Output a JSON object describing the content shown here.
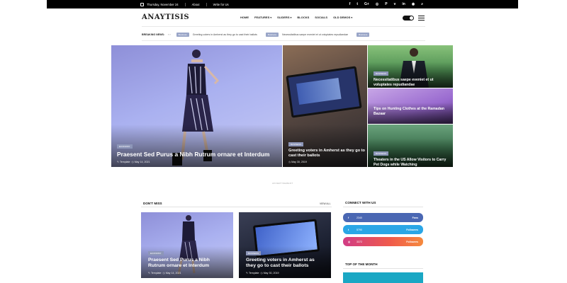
{
  "topbar": {
    "date": "Thursday, November 24",
    "links": [
      "About",
      "Write for Us"
    ],
    "social_icons": [
      "facebook-icon",
      "twitter-icon",
      "google-plus-icon",
      "instagram-icon",
      "pinterest-icon",
      "vimeo-icon",
      "linkedin-icon",
      "rss-icon",
      "search-icon"
    ],
    "social_glyphs": [
      "f",
      "t",
      "G+",
      "◎",
      "P",
      "v",
      "in",
      "◉",
      "⌕"
    ]
  },
  "header": {
    "logo": "ANAYTISIS",
    "nav": [
      "HOME",
      "FEATURES",
      "SLIDERS",
      "BLOCKS",
      "SOCIALS",
      "OLD DEMOS"
    ]
  },
  "breaking": {
    "label": "BREAKING NEWS:",
    "arrows": "‹ ›",
    "items": [
      {
        "tag": "Business",
        "text": "Greeting voters in Amherst as they go to cast their ballots"
      },
      {
        "tag": "Business",
        "text": "Necessitatibus saepe eveniet et ut voluptates repudiandae"
      },
      {
        "tag": "Business",
        "text": ""
      }
    ]
  },
  "hero": {
    "main": {
      "badge": "ECONOMY",
      "title": "Praesent Sed Purus a Nibh Rutrum ornare et Interdum",
      "author": "Template",
      "date": "May 14, 2021"
    },
    "second": {
      "badge": "BUSINESS",
      "title": "Greeting voters in Amherst as they go to cast their ballots",
      "date": "May 30, 2019"
    },
    "side": [
      {
        "badge": "BUSINESS",
        "title": "Necessitatibus saepe eveniet et ut voluptates repudiandae"
      },
      {
        "badge": "",
        "title": "Tips on Hunting Clothes at the Ramadan Bazaar"
      },
      {
        "badge": "BUSINESS",
        "title": "Theaters in the US Allow Visitors to Carry Pet Dogs while Watching"
      }
    ]
  },
  "advertisement": "ADVERTISEMENT",
  "dont_miss": {
    "title": "DON'T MISS",
    "view_all": "VIEW ALL",
    "cards": [
      {
        "badge": "ECONOMY",
        "title": "Praesent Sed Purus a Nibh Rutrum ornare et Interdum",
        "author": "Template",
        "date": "May 14, 2021"
      },
      {
        "badge": "BUSINESS",
        "title": "Greeting voters in Amherst as they go to cast their ballots",
        "author": "Template",
        "date": "May 30, 2019"
      }
    ]
  },
  "connect": {
    "title": "CONNECT WITH US",
    "rows": [
      {
        "icon": "facebook-icon",
        "glyph": "f",
        "count": "2340",
        "action": "Fans",
        "color": "#4a67b3"
      },
      {
        "icon": "twitter-icon",
        "glyph": "t",
        "count": "5790",
        "action": "Followers",
        "color": "#2aa6e6"
      },
      {
        "icon": "instagram-icon",
        "glyph": "◎",
        "count": "3372",
        "action": "Followers",
        "color": "#d13c85"
      }
    ]
  },
  "top_month": {
    "title": "TOP OF THE MONTH"
  }
}
